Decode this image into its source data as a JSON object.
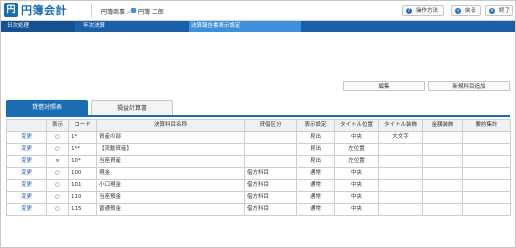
{
  "app": {
    "logo_char": "円",
    "title": "円簿会計",
    "company": "円簿商事 ／",
    "user": "円簿 二郎"
  },
  "toolbar": {
    "help_label": "操作方法",
    "help_icon": "?",
    "back_label": "戻る",
    "back_icon": "«",
    "exit_label": "終了",
    "exit_icon": "×"
  },
  "breadcrumb": [
    "日次処理",
    "年次決算",
    "決算報告書表示設定"
  ],
  "actions": {
    "edit_label": "編集",
    "add_label": "新規科目追加"
  },
  "tabs": [
    "貸借対照表",
    "損益計算書"
  ],
  "table": {
    "headers": [
      "",
      "表示",
      "コード",
      "決算科目名称",
      "貸借区分",
      "表示設定",
      "タイトル位置",
      "タイトル装飾",
      "金額装飾",
      "要約集計"
    ],
    "rows": [
      [
        "変更",
        "○",
        "1*",
        "資産の部",
        "",
        "見出",
        "中央",
        "大文字",
        "",
        ""
      ],
      [
        "変更",
        "○",
        "1**",
        "【流動資産】",
        "",
        "見出",
        "左位置",
        "",
        "",
        ""
      ],
      [
        "変更",
        "×",
        "10*",
        "当座資産",
        "",
        "見出",
        "左位置",
        "",
        "",
        ""
      ],
      [
        "変更",
        "○",
        "100",
        "現金",
        "借方科目",
        "通常",
        "中央",
        "",
        "",
        ""
      ],
      [
        "変更",
        "○",
        "101",
        "小口現金",
        "借方科目",
        "通常",
        "中央",
        "",
        "",
        ""
      ],
      [
        "変更",
        "○",
        "110",
        "当座預金",
        "借方科目",
        "通常",
        "中央",
        "",
        "",
        ""
      ],
      [
        "変更",
        "○",
        "115",
        "普通預金",
        "借方科目",
        "通常",
        "中央",
        "",
        "",
        ""
      ]
    ]
  }
}
